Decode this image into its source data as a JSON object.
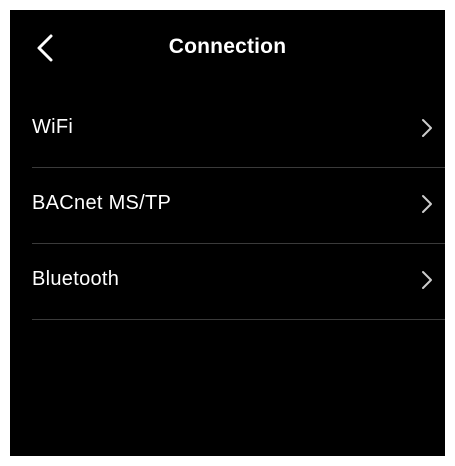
{
  "header": {
    "title": "Connection",
    "back_icon": "chevron-left-icon"
  },
  "menu": {
    "items": [
      {
        "label": "WiFi",
        "icon": "chevron-right-icon"
      },
      {
        "label": "BACnet MS/TP",
        "icon": "chevron-right-icon"
      },
      {
        "label": "Bluetooth",
        "icon": "chevron-right-icon"
      }
    ]
  },
  "colors": {
    "background": "#000000",
    "text": "#ffffff",
    "divider": "#3a3a3a",
    "chevron": "#cccccc"
  }
}
